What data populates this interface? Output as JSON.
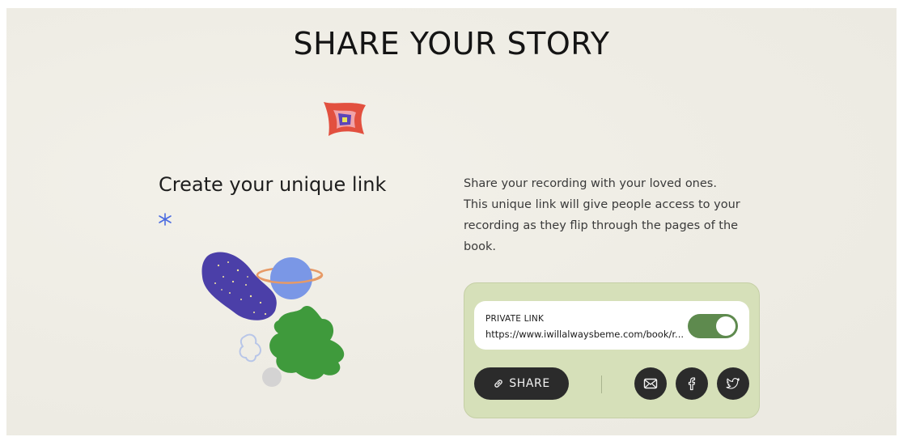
{
  "header": {
    "title": "SHARE YOUR STORY"
  },
  "section": {
    "heading": "Create your unique link",
    "description_lines": [
      "Share your recording with your loved ones.",
      "This unique link will give people access to your",
      "recording as they flip through the pages of the",
      "book."
    ]
  },
  "share_card": {
    "private_link_label": "PRIVATE LINK",
    "private_link_url": "https://www.iwillalwaysbeme.com/book/r...",
    "toggle_on": true,
    "share_button_label": "SHARE",
    "social_buttons": [
      "email-icon",
      "facebook-icon",
      "twitter-icon"
    ]
  },
  "colors": {
    "card_bg": "#d6e0b9",
    "toggle_on": "#5e8a4e",
    "button_dark": "#2b2b2b",
    "illustration_purple": "#4b3fa8",
    "illustration_green": "#3f9a3c",
    "illustration_blue": "#7a97e6"
  }
}
